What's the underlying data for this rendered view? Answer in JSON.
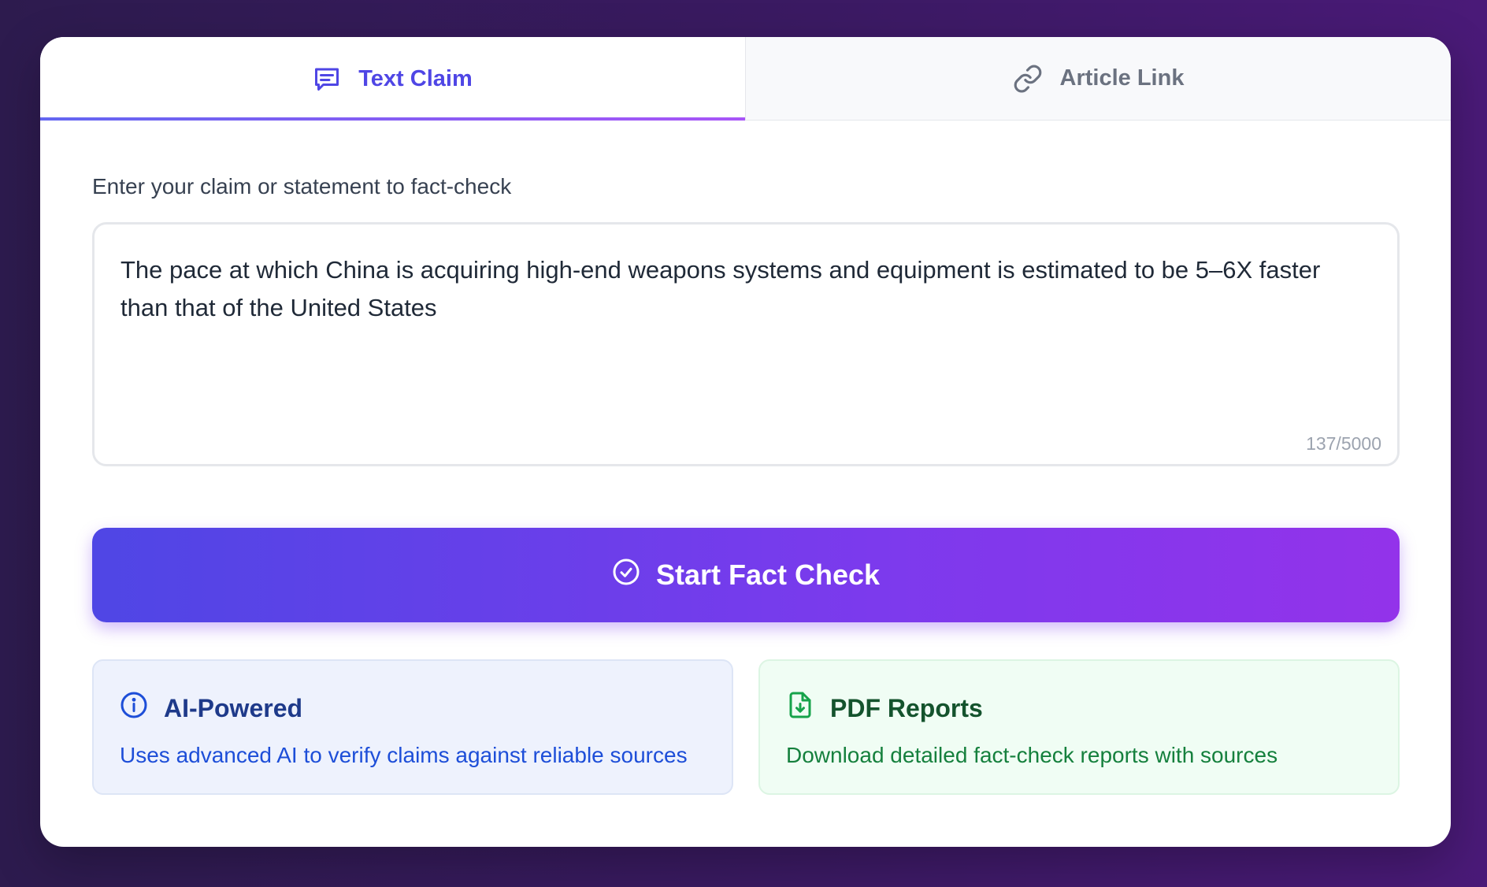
{
  "tabs": [
    {
      "label": "Text Claim",
      "icon": "message-square-text-icon",
      "active": true
    },
    {
      "label": "Article Link",
      "icon": "link-icon",
      "active": false
    }
  ],
  "form": {
    "label": "Enter your claim or statement to fact-check",
    "claim_value": "The pace at which China is acquiring high-end weapons systems and equipment is estimated to be 5–6X faster than that of the United States",
    "char_count": "137/5000"
  },
  "submit": {
    "label": "Start Fact Check",
    "icon": "circle-check-icon"
  },
  "features": [
    {
      "title": "AI-Powered",
      "description": "Uses advanced AI to verify claims against reliable sources",
      "icon": "info-icon",
      "color": "#1e3a8a"
    },
    {
      "title": "PDF Reports",
      "description": "Download detailed fact-check reports with sources",
      "icon": "file-download-icon",
      "color": "#15803d"
    }
  ],
  "colors": {
    "accent": "#4f46e5",
    "accent_end": "#9333ea",
    "background_start": "#2d1b4e",
    "background_end": "#4a1a78"
  }
}
